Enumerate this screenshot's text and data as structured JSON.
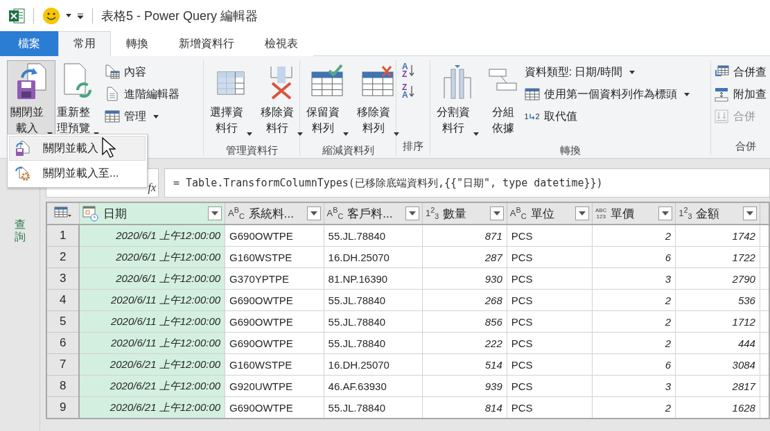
{
  "title_bar": {
    "title": "表格5 - Power Query 編輯器"
  },
  "menu_tabs": [
    {
      "label": "檔案",
      "kind": "file",
      "selected": false
    },
    {
      "label": "常用",
      "kind": "tab",
      "selected": true
    },
    {
      "label": "轉換",
      "kind": "tab",
      "selected": false
    },
    {
      "label": "新增資料行",
      "kind": "tab",
      "selected": false
    },
    {
      "label": "檢視表",
      "kind": "tab",
      "selected": false
    }
  ],
  "ribbon": {
    "groups": [
      {
        "items": [
          {
            "kind": "large",
            "label": "關閉並載入",
            "dropdown": true,
            "open": true
          }
        ]
      },
      {
        "items": [
          {
            "kind": "large",
            "label": "重新整理預覽",
            "dropdown": true,
            "open": false
          },
          {
            "kind": "stack",
            "items": [
              {
                "label": "內容",
                "dropdown": false,
                "disabled": false
              },
              {
                "label": "進階編輯器",
                "dropdown": false,
                "disabled": false
              },
              {
                "label": "管理",
                "dropdown": true,
                "disabled": false
              }
            ]
          }
        ]
      },
      {
        "label": "管理資料行",
        "items": [
          {
            "kind": "large",
            "label": "選擇資料行",
            "dropdown": true,
            "open": false
          },
          {
            "kind": "large",
            "label": "移除資料行",
            "dropdown": true,
            "open": false
          }
        ]
      },
      {
        "label": "縮減資料列",
        "items": [
          {
            "kind": "large",
            "label": "保留資料列",
            "dropdown": true,
            "open": false
          },
          {
            "kind": "large",
            "label": "移除資料列",
            "dropdown": true,
            "open": false
          }
        ]
      },
      {
        "label": "排序",
        "items": [
          {
            "kind": "sort",
            "buttons": [
              {
                "letters": [
                  {
                    "text": "A",
                    "color": "#3f6fb5"
                  },
                  {
                    "text": "Z",
                    "color": "#8040a8"
                  }
                ]
              },
              {
                "letters": [
                  {
                    "text": "Z",
                    "color": "#8040a8"
                  },
                  {
                    "text": "A",
                    "color": "#3f6fb5"
                  }
                ]
              }
            ]
          }
        ]
      },
      {
        "label": "轉換",
        "items": [
          {
            "kind": "large",
            "label": "分割資料行",
            "dropdown": true,
            "open": false
          },
          {
            "kind": "large",
            "label": "分組依據",
            "dropdown": false,
            "open": false
          },
          {
            "kind": "stack",
            "items": [
              {
                "label": "資料類型: 日期/時間",
                "dropdown": true,
                "disabled": false
              },
              {
                "label": "使用第一個資料列作為標頭",
                "dropdown": true,
                "disabled": false
              },
              {
                "icon_text": [
                  "1",
                  "2"
                ],
                "label": "取代值",
                "dropdown": false,
                "disabled": false
              }
            ]
          }
        ]
      },
      {
        "label": "合併",
        "items": [
          {
            "kind": "stack",
            "items": [
              {
                "label": "合併查",
                "dropdown": false,
                "disabled": false
              },
              {
                "label": "附加查",
                "dropdown": false,
                "disabled": false
              },
              {
                "label": "合併",
                "dropdown": false,
                "disabled": true
              }
            ]
          }
        ]
      }
    ]
  },
  "dropdown_menu": {
    "items": [
      {
        "label": "關閉並載入",
        "selected": true
      },
      {
        "label": "關閉並載入至...",
        "selected": false
      }
    ]
  },
  "sidebar": {
    "label": "查詢"
  },
  "formula_bar": {
    "fx": "fx",
    "formula": "= Table.TransformColumnTypes(已移除底端資料列,{{\"日期\", type datetime}})"
  },
  "table": {
    "columns": [
      {
        "name": "日期",
        "kind": "datetime",
        "selected": true
      },
      {
        "name": "系統料...",
        "kind": "text",
        "type_icon": "A$^{B}$$_{C}$",
        "selected": false
      },
      {
        "name": "客戶料...",
        "kind": "text",
        "type_icon": "A$^{B}$$_{C}$",
        "selected": false
      },
      {
        "name": "數量",
        "kind": "number",
        "type_icon": "1$^{2}$$_{3}$",
        "selected": false
      },
      {
        "name": "單位",
        "kind": "text",
        "type_icon": "A$^{B}$$_{C}$",
        "selected": false
      },
      {
        "name": "單價",
        "kind": "any",
        "type_icon": "ABC\n123",
        "selected": false
      },
      {
        "name": "金額",
        "kind": "number",
        "type_icon": "1$^{2}$$_{3}$",
        "selected": false
      }
    ],
    "rows": [
      {
        "number": "1",
        "cells": [
          "2020/6/1 上午12:00:00",
          "G690OWTPE",
          "55.JL.78840",
          "871",
          "PCS",
          "2",
          "1742"
        ]
      },
      {
        "number": "2",
        "cells": [
          "2020/6/1 上午12:00:00",
          "G160WSTPE",
          "16.DH.25070",
          "287",
          "PCS",
          "6",
          "1722"
        ]
      },
      {
        "number": "3",
        "cells": [
          "2020/6/1 上午12:00:00",
          "G370YPTPE",
          "81.NP.16390",
          "930",
          "PCS",
          "3",
          "2790"
        ]
      },
      {
        "number": "4",
        "cells": [
          "2020/6/11 上午12:00:00",
          "G690OWTPE",
          "55.JL.78840",
          "268",
          "PCS",
          "2",
          "536"
        ]
      },
      {
        "number": "5",
        "cells": [
          "2020/6/11 上午12:00:00",
          "G690OWTPE",
          "55.JL.78840",
          "856",
          "PCS",
          "2",
          "1712"
        ]
      },
      {
        "number": "6",
        "cells": [
          "2020/6/11 上午12:00:00",
          "G690OWTPE",
          "55.JL.78840",
          "222",
          "PCS",
          "2",
          "444"
        ]
      },
      {
        "number": "7",
        "cells": [
          "2020/6/21 上午12:00:00",
          "G160WSTPE",
          "16.DH.25070",
          "514",
          "PCS",
          "6",
          "3084"
        ]
      },
      {
        "number": "8",
        "cells": [
          "2020/6/21 上午12:00:00",
          "G920UWTPE",
          "46.AF.63930",
          "939",
          "PCS",
          "3",
          "2817"
        ]
      },
      {
        "number": "9",
        "cells": [
          "2020/6/21 上午12:00:00",
          "G690OWTPE",
          "55.JL.78840",
          "814",
          "PCS",
          "2",
          "1628"
        ]
      }
    ]
  }
}
